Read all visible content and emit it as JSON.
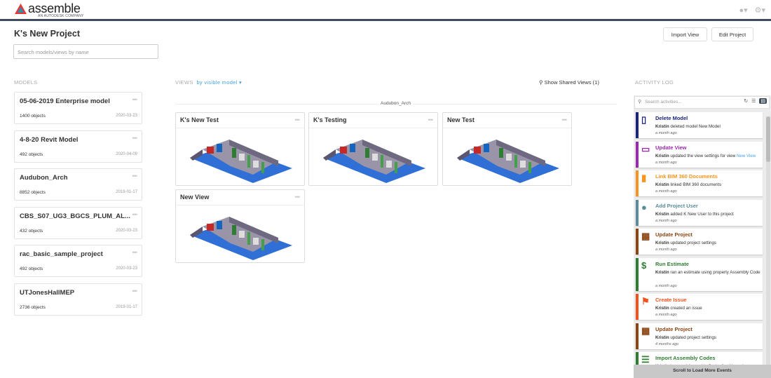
{
  "header": {
    "logo_text": "assemble",
    "logo_sub": "AN AUTODESK COMPANY",
    "user_icon": "user-icon",
    "settings_icon": "gear-icon"
  },
  "project": {
    "title": "K's New Project",
    "search_placeholder": "Search models/views by name",
    "import_view": "Import View",
    "edit_project": "Edit Project"
  },
  "models": {
    "label": "MODELS",
    "items": [
      {
        "name": "05-06-2019 Enterprise model",
        "count": "1400 objects",
        "date": "2020-03-23"
      },
      {
        "name": "4-8-20 Revit Model",
        "count": "492 objects",
        "date": "2020-04-09"
      },
      {
        "name": "Audubon_Arch",
        "count": "8852 objects",
        "date": "2019-01-17"
      },
      {
        "name": "CBS_S07_UG3_BGCS_PLUM_AL...",
        "count": "432 objects",
        "date": "2020-03-23"
      },
      {
        "name": "rac_basic_sample_project",
        "count": "492 objects",
        "date": "2020-03-23"
      },
      {
        "name": "UTJonesHallMEP",
        "count": "2736 objects",
        "date": "2019-01-17"
      }
    ]
  },
  "views": {
    "label": "VIEWS",
    "by": "by visible model",
    "shared": "Show Shared Views (1)",
    "group": "Audubon_Arch",
    "items": [
      {
        "name": "K's New Test"
      },
      {
        "name": "K's Testing"
      },
      {
        "name": "New Test"
      },
      {
        "name": "New View"
      }
    ]
  },
  "activity": {
    "label": "ACTIVITY LOG",
    "search_placeholder": "Search activities...",
    "load_more": "Scroll to Load More Events",
    "items": [
      {
        "title": "Delete Model",
        "user": "Kristin",
        "text": " deleted model New Model",
        "link": "",
        "time": "a month ago",
        "color": "#1a237e",
        "icon": "device-icon"
      },
      {
        "title": "Update View",
        "user": "Kristin",
        "text": " updated the view settings for view ",
        "link": "New View",
        "time": "a month ago",
        "color": "#9c27b0",
        "icon": "monitor-icon"
      },
      {
        "title": "Link BIM 360 Documents",
        "user": "Kristin",
        "text": " linked BIM 360 documents",
        "link": "",
        "time": "a month ago",
        "color": "#f7941d",
        "icon": "document-icon"
      },
      {
        "title": "Add Project User",
        "user": "Kristin",
        "text": " added K New User to this project",
        "link": "",
        "time": "a month ago",
        "color": "#5b8c9a",
        "icon": "user-add-icon"
      },
      {
        "title": "Update Project",
        "user": "Kristin",
        "text": " updated project settings",
        "link": "",
        "time": "a month ago",
        "color": "#8b4513",
        "icon": "building-icon"
      },
      {
        "title": "Run Estimate",
        "user": "Kristin",
        "text": " ran an estimate using property Assembly Code",
        "link": "",
        "time": "a month ago",
        "color": "#2e7d32",
        "icon": "dollar-icon"
      },
      {
        "title": "Create Issue",
        "user": "Kristin",
        "text": " created an issue",
        "link": "",
        "time": "a month ago",
        "color": "#f4511e",
        "icon": "flag-icon"
      },
      {
        "title": "Update Project",
        "user": "Kristin",
        "text": " updated project settings",
        "link": "",
        "time": "4 months ago",
        "color": "#8b4513",
        "icon": "building-icon"
      },
      {
        "title": "Import Assembly Codes",
        "user": "Kristin",
        "text": " imported Assembly Codes for this project",
        "link": "",
        "time": "",
        "color": "#2e7d32",
        "icon": "list-icon"
      }
    ]
  }
}
